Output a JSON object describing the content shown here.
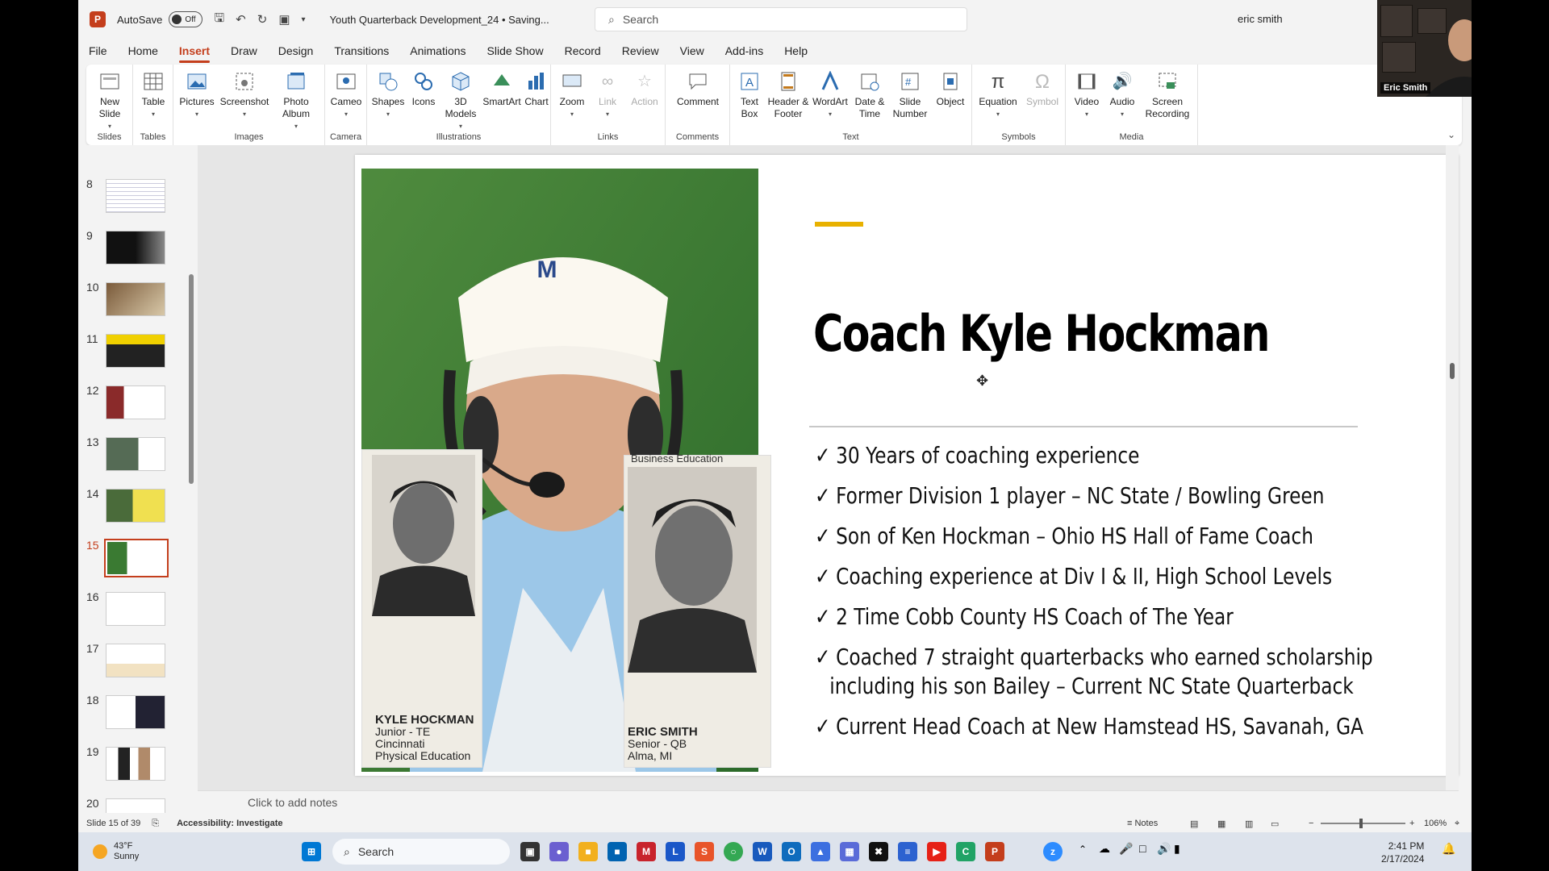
{
  "titlebar": {
    "autosave_label": "AutoSave",
    "autosave_state": "Off",
    "document_title": "Youth Quarterback Development_24 • Saving...",
    "search_placeholder": "Search",
    "user_name": "eric smith"
  },
  "menu": [
    "File",
    "Home",
    "Insert",
    "Draw",
    "Design",
    "Transitions",
    "Animations",
    "Slide Show",
    "Record",
    "Review",
    "View",
    "Add-ins",
    "Help"
  ],
  "menu_active": "Insert",
  "ribbon": {
    "groups": [
      {
        "label": "Slides",
        "buttons": [
          "New Slide"
        ]
      },
      {
        "label": "Tables",
        "buttons": [
          "Table"
        ]
      },
      {
        "label": "Images",
        "buttons": [
          "Pictures",
          "Screenshot",
          "Photo Album"
        ]
      },
      {
        "label": "Camera",
        "buttons": [
          "Cameo"
        ]
      },
      {
        "label": "Illustrations",
        "buttons": [
          "Shapes",
          "Icons",
          "3D Models",
          "SmartArt",
          "Chart"
        ]
      },
      {
        "label": "Links",
        "buttons": [
          "Zoom",
          "Link",
          "Action"
        ]
      },
      {
        "label": "Comments",
        "buttons": [
          "Comment"
        ]
      },
      {
        "label": "Text",
        "buttons": [
          "Text Box",
          "Header & Footer",
          "WordArt",
          "Date & Time",
          "Slide Number",
          "Object"
        ]
      },
      {
        "label": "Symbols",
        "buttons": [
          "Equation",
          "Symbol"
        ]
      },
      {
        "label": "Media",
        "buttons": [
          "Video",
          "Audio",
          "Screen Recording"
        ]
      }
    ]
  },
  "thumbnails": {
    "numbers": [
      "8",
      "9",
      "10",
      "11",
      "12",
      "13",
      "14",
      "15",
      "16",
      "17",
      "18",
      "19",
      "20"
    ],
    "active": "15"
  },
  "slide": {
    "title": "Coach Kyle Hockman",
    "bullets": [
      {
        "text": "30 Years of coaching experience"
      },
      {
        "text": "Former Division 1 player – NC State / Bowling Green"
      },
      {
        "text": "Son of Ken Hockman – Ohio HS Hall of Fame Coach"
      },
      {
        "text": "Coaching experience at Div I & II, High School Levels"
      },
      {
        "text": "2 Time Cobb County HS Coach of The Year"
      },
      {
        "text": "Coached 7 straight quarterbacks who earned scholarship",
        "cont": "including his   son Bailey –  Current NC State Quarterback"
      },
      {
        "text": "Current Head Coach at New Hamstead HS, Savanah, GA"
      }
    ],
    "yearbook_left": {
      "name": "KYLE HOCKMAN",
      "line2": "Junior - TE",
      "line3": "Cincinnati",
      "line4": "Physical Education"
    },
    "yearbook_right": {
      "header": "Business Education",
      "name": "ERIC SMITH",
      "line2": "Senior - QB",
      "line3": "Alma, MI"
    }
  },
  "notes_placeholder": "Click to add notes",
  "status": {
    "slide_count": "Slide 15 of 39",
    "accessibility": "Accessibility: Investigate",
    "notes_label": "Notes",
    "zoom": "106%"
  },
  "webcam": {
    "name": "Eric Smith"
  },
  "taskbar": {
    "weather_temp": "43°F",
    "weather_desc": "Sunny",
    "search_placeholder": "Search",
    "time": "2:41 PM",
    "date": "2/17/2024"
  },
  "colors": {
    "accent": "#c43e1c",
    "title_bar_accent": "#e8b100",
    "photo_green": "#3a7a32"
  }
}
